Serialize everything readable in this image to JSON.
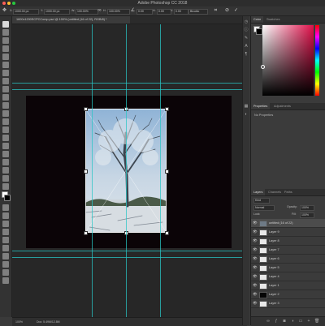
{
  "window": {
    "title": "Adobe Photoshop CC 2018",
    "traffic_lights": [
      "#ff5f57",
      "#febc2e",
      "#28c840"
    ]
  },
  "options_bar": {
    "x_value": "1000.00 px",
    "y_value": "1000.00 px",
    "w_value": "100.00%",
    "h_value": "100.00%",
    "angle_value": "0.00",
    "h_skew": "0.00",
    "v_skew": "0.00",
    "interp": "Bicubic",
    "cancel_icon": "⊘",
    "commit_icon": "✓"
  },
  "document": {
    "tab_title": "1600x1200SCPCComp.psd @ 100% (untitled (16 of 22), RGB/8) *"
  },
  "status_bar": {
    "zoom": "100%",
    "doc_info": "Doc: 5.49M/12.8M"
  },
  "color_panel": {
    "tabs": [
      "Color",
      "Swatches"
    ],
    "foreground": "#ffffff",
    "background": "#000000"
  },
  "properties_panel": {
    "tabs": [
      "Properties",
      "Adjustments"
    ],
    "message": "No Properties"
  },
  "layers_panel": {
    "tabs": [
      "Layers",
      "Channels",
      "Paths"
    ],
    "kind_label": "Kind",
    "blend_mode": "Normal",
    "opacity_label": "Opacity:",
    "opacity_value": "100%",
    "lock_label": "Lock:",
    "fill_label": "Fill:",
    "fill_value": "100%",
    "layers": [
      {
        "name": "untitled (16 of 22)",
        "thumb": "#6e7a86",
        "selected": true
      },
      {
        "name": "Layer 9",
        "thumb": "#e8e8e8",
        "selected": false
      },
      {
        "name": "Layer 8",
        "thumb": "#e8e8e8",
        "selected": false
      },
      {
        "name": "Layer 7",
        "thumb": "#e8e8e8",
        "selected": false
      },
      {
        "name": "Layer 6",
        "thumb": "#e8e8e8",
        "selected": false
      },
      {
        "name": "Layer 5",
        "thumb": "#e8e8e8",
        "selected": false
      },
      {
        "name": "Layer 4",
        "thumb": "#e8e8e8",
        "selected": false
      },
      {
        "name": "Layer 1",
        "thumb": "#e8e8e8",
        "selected": false
      },
      {
        "name": "Layer 2",
        "thumb": "#050505",
        "selected": false
      },
      {
        "name": "Layer 3",
        "thumb": "#e8e8e8",
        "selected": false
      }
    ]
  },
  "colors": {
    "guide": "#2ac6c6",
    "canvas": "#0b0407",
    "pasteboard": "#272727"
  }
}
